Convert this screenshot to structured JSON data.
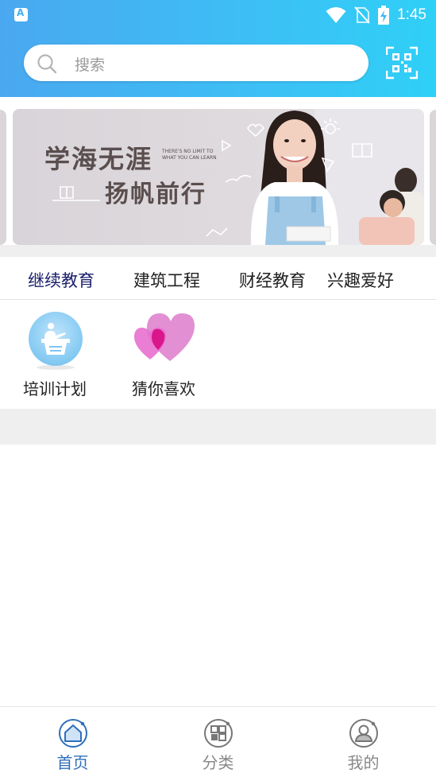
{
  "status_bar": {
    "time": "1:45"
  },
  "search": {
    "placeholder": "搜索"
  },
  "banner": {
    "title_line1": "学海无涯",
    "title_line2": "扬帆前行",
    "small_text": "THERE'S NO LIMIT TO WHAT YOU CAN LEARN"
  },
  "tabs": [
    {
      "label": "继续教育",
      "active": true
    },
    {
      "label": "建筑工程",
      "active": false
    },
    {
      "label": "财经教育",
      "active": false
    },
    {
      "label": "兴趣爱好",
      "active": false
    }
  ],
  "features": [
    {
      "label": "培训计划",
      "icon": "lecturer-podium-icon"
    },
    {
      "label": "猜你喜欢",
      "icon": "hearts-icon"
    }
  ],
  "bottom_nav": [
    {
      "label": "首页",
      "icon": "home-icon",
      "active": true
    },
    {
      "label": "分类",
      "icon": "category-grid-icon",
      "active": false
    },
    {
      "label": "我的",
      "icon": "user-profile-icon",
      "active": false
    }
  ],
  "colors": {
    "header_gradient_start": "#4aa8f0",
    "header_gradient_end": "#2fd0f7",
    "active_tab": "#1a1f6b",
    "active_nav": "#2f6fba",
    "inactive_nav": "#888888"
  }
}
